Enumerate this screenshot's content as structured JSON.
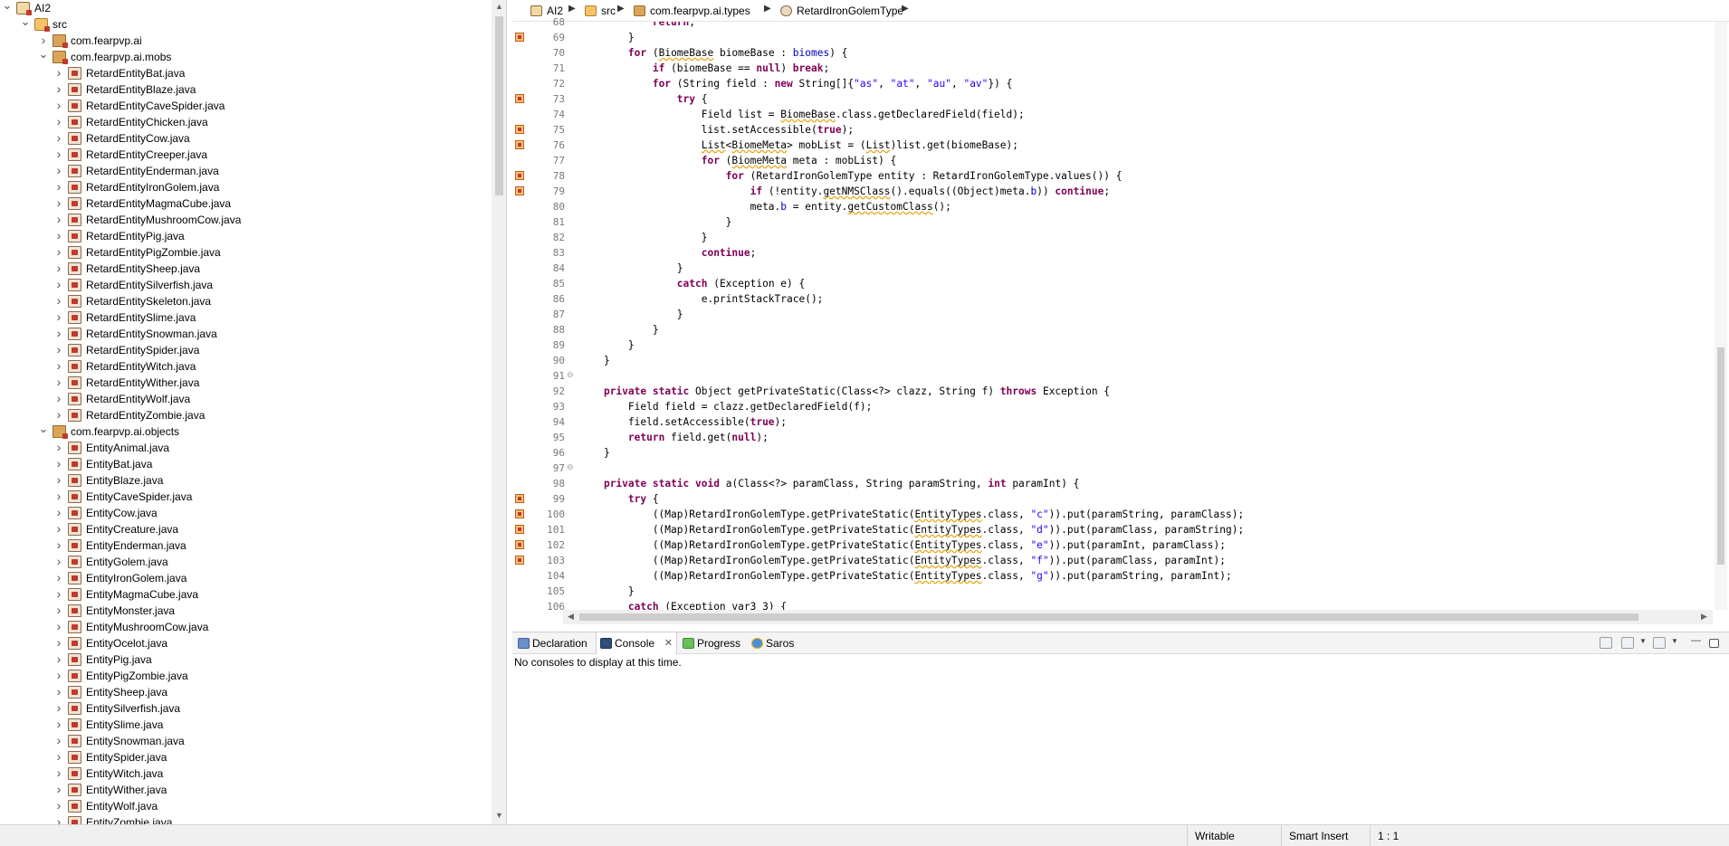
{
  "explorer": {
    "project": "AI2",
    "src": "src",
    "pkg_root": "com.fearpvp.ai",
    "pkg_mobs": "com.fearpvp.ai.mobs",
    "mobs": [
      "RetardEntityBat.java",
      "RetardEntityBlaze.java",
      "RetardEntityCaveSpider.java",
      "RetardEntityChicken.java",
      "RetardEntityCow.java",
      "RetardEntityCreeper.java",
      "RetardEntityEnderman.java",
      "RetardEntityIronGolem.java",
      "RetardEntityMagmaCube.java",
      "RetardEntityMushroomCow.java",
      "RetardEntityPig.java",
      "RetardEntityPigZombie.java",
      "RetardEntitySheep.java",
      "RetardEntitySilverfish.java",
      "RetardEntitySkeleton.java",
      "RetardEntitySlime.java",
      "RetardEntitySnowman.java",
      "RetardEntitySpider.java",
      "RetardEntityWitch.java",
      "RetardEntityWither.java",
      "RetardEntityWolf.java",
      "RetardEntityZombie.java"
    ],
    "pkg_objects": "com.fearpvp.ai.objects",
    "objects": [
      "EntityAnimal.java",
      "EntityBat.java",
      "EntityBlaze.java",
      "EntityCaveSpider.java",
      "EntityCow.java",
      "EntityCreature.java",
      "EntityEnderman.java",
      "EntityGolem.java",
      "EntityIronGolem.java",
      "EntityMagmaCube.java",
      "EntityMonster.java",
      "EntityMushroomCow.java",
      "EntityOcelot.java",
      "EntityPig.java",
      "EntityPigZombie.java",
      "EntitySheep.java",
      "EntitySilverfish.java",
      "EntitySlime.java",
      "EntitySnowman.java",
      "EntitySpider.java",
      "EntityWitch.java",
      "EntityWither.java",
      "EntityWolf.java",
      "EntityZombie.java"
    ]
  },
  "breadcrumb": [
    "AI2",
    "src",
    "com.fearpvp.ai.types",
    "RetardIronGolemType"
  ],
  "editor": {
    "first_line": 68,
    "lines": [
      "            return;",
      "        }",
      "        for (BiomeBase biomeBase : biomes) {",
      "            if (biomeBase == null) break;",
      "            for (String field : new String[]{\"as\", \"at\", \"au\", \"av\"}) {",
      "                try {",
      "                    Field list = BiomeBase.class.getDeclaredField(field);",
      "                    list.setAccessible(true);",
      "                    List<BiomeMeta> mobList = (List)list.get(biomeBase);",
      "                    for (BiomeMeta meta : mobList) {",
      "                        for (RetardIronGolemType entity : RetardIronGolemType.values()) {",
      "                            if (!entity.getNMSClass().equals((Object)meta.b)) continue;",
      "                            meta.b = entity.getCustomClass();",
      "                        }",
      "                    }",
      "                    continue;",
      "                }",
      "                catch (Exception e) {",
      "                    e.printStackTrace();",
      "                }",
      "            }",
      "        }",
      "    }",
      "",
      "    private static Object getPrivateStatic(Class<?> clazz, String f) throws Exception {",
      "        Field field = clazz.getDeclaredField(f);",
      "        field.setAccessible(true);",
      "        return field.get(null);",
      "    }",
      "",
      "    private static void a(Class<?> paramClass, String paramString, int paramInt) {",
      "        try {",
      "            ((Map)RetardIronGolemType.getPrivateStatic(EntityTypes.class, \"c\")).put(paramString, paramClass);",
      "            ((Map)RetardIronGolemType.getPrivateStatic(EntityTypes.class, \"d\")).put(paramClass, paramString);",
      "            ((Map)RetardIronGolemType.getPrivateStatic(EntityTypes.class, \"e\")).put(paramInt, paramClass);",
      "            ((Map)RetardIronGolemType.getPrivateStatic(EntityTypes.class, \"f\")).put(paramClass, paramInt);",
      "            ((Map)RetardIronGolemType.getPrivateStatic(EntityTypes.class, \"g\")).put(paramString, paramInt);",
      "        }",
      "        catch (Exception var3_3) {"
    ]
  },
  "console": {
    "tabs": [
      "Declaration",
      "Console",
      "Progress",
      "Saros"
    ],
    "active_tab": "Console",
    "message": "No consoles to display at this time."
  },
  "status": {
    "writable": "Writable",
    "insert_mode": "Smart Insert",
    "position": "1 : 1"
  },
  "colors": {
    "keyword": "#7f0055",
    "string": "#2a00ff",
    "field": "#0000c0",
    "warning_underline": "#e8a000"
  }
}
